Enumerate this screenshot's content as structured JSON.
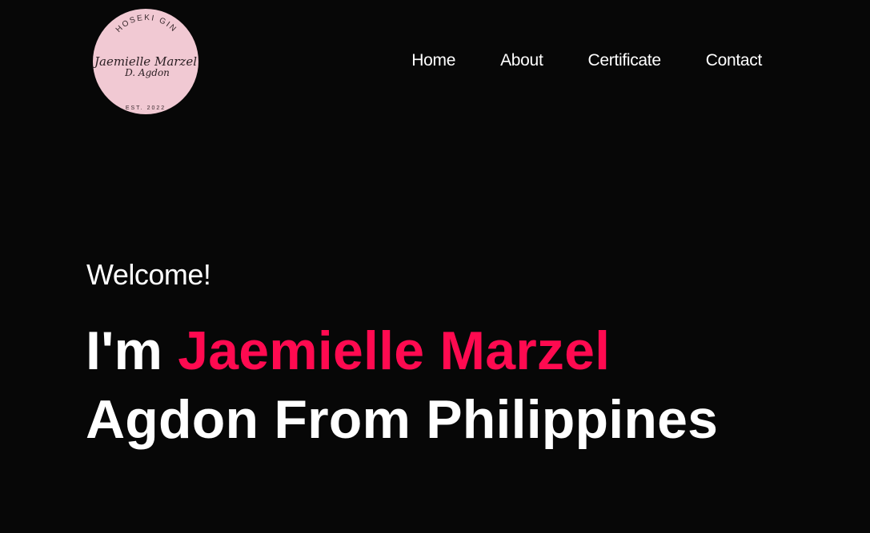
{
  "logo": {
    "top_text": "HOSEKI GIN",
    "script_line1": "Jaemielle Marzel",
    "script_line2": "D. Agdon",
    "bottom_text": "EST. 2022",
    "color": "#f1c9d3"
  },
  "nav": {
    "items": [
      {
        "label": "Home"
      },
      {
        "label": "About"
      },
      {
        "label": "Certificate"
      },
      {
        "label": "Contact"
      }
    ]
  },
  "hero": {
    "welcome": "Welcome!",
    "prefix": "I'm ",
    "name": "Jaemielle Marzel",
    "line2": "Agdon From Philippines",
    "accent_color": "#ff0a50"
  },
  "colors": {
    "background": "#070707",
    "text": "#ffffff"
  }
}
